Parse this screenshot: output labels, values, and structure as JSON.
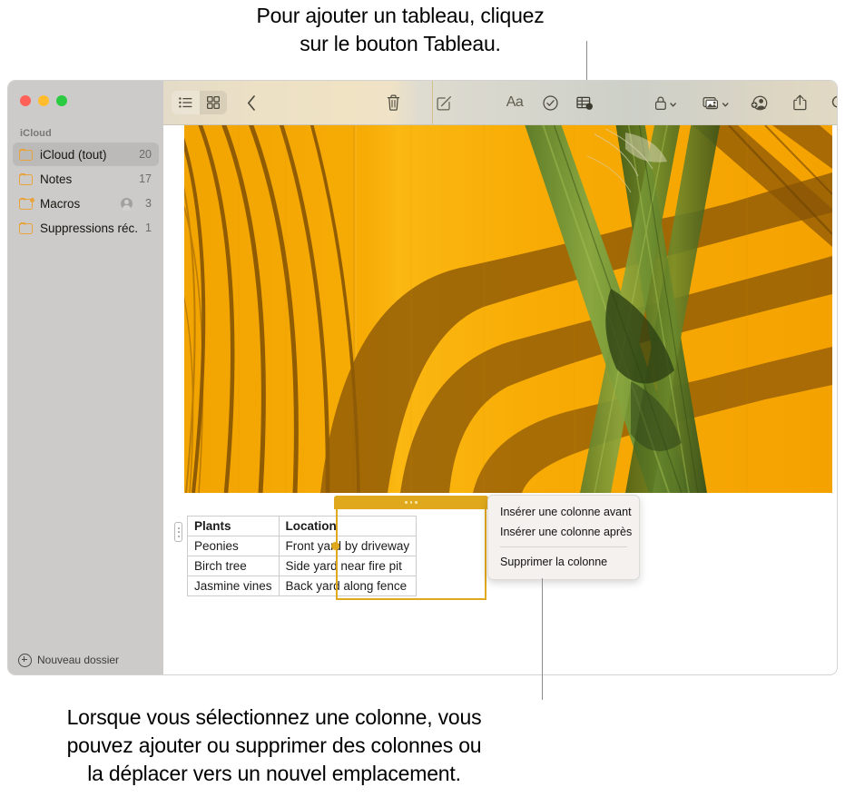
{
  "callouts": {
    "top": "Pour ajouter un tableau, cliquez\nsur le bouton Tableau.",
    "bottom": "Lorsque vous sélectionnez une colonne, vous\npouvez ajouter ou supprimer des colonnes ou\nla déplacer vers un nouvel emplacement."
  },
  "window": {
    "traffic_lights": [
      "close",
      "minimize",
      "zoom"
    ]
  },
  "sidebar": {
    "section_title": "iCloud",
    "items": [
      {
        "label": "iCloud (tout)",
        "count": "20",
        "selected": true,
        "shared": false,
        "person": false
      },
      {
        "label": "Notes",
        "count": "17",
        "selected": false,
        "shared": false,
        "person": false
      },
      {
        "label": "Macros",
        "count": "3",
        "selected": false,
        "shared": true,
        "person": true
      },
      {
        "label": "Suppressions réc...",
        "count": "1",
        "selected": false,
        "shared": false,
        "person": false
      }
    ],
    "new_folder_label": "Nouveau dossier"
  },
  "toolbar": {
    "view_list": "list-view",
    "view_grid": "grid-view",
    "back": "back",
    "delete": "delete",
    "compose": "compose",
    "format": "Aa",
    "checklist": "checklist",
    "table": "table",
    "lock": "lock",
    "media": "media",
    "collaborate": "add-people",
    "share": "share",
    "search": "search"
  },
  "note": {
    "image_alt": "palm frond shadows on orange wall"
  },
  "table": {
    "columns": [
      "Plants",
      "Location"
    ],
    "rows": [
      [
        "Peonies",
        "Front yard by driveway"
      ],
      [
        "Birch tree",
        "Side yard near fire pit"
      ],
      [
        "Jasmine vines",
        "Back yard along fence"
      ]
    ],
    "selected_column_index": 1
  },
  "context_menu": {
    "items": [
      {
        "label": "Insérer une colonne avant",
        "separator_after": false
      },
      {
        "label": "Insérer une colonne après",
        "separator_after": true
      },
      {
        "label": "Supprimer la colonne",
        "separator_after": false
      }
    ]
  },
  "colors": {
    "accent_amber": "#e0a81c",
    "folder_orange": "#e8a33d",
    "sidebar_bg": "#cdcbc9",
    "selected_row": "#bcbab8"
  }
}
